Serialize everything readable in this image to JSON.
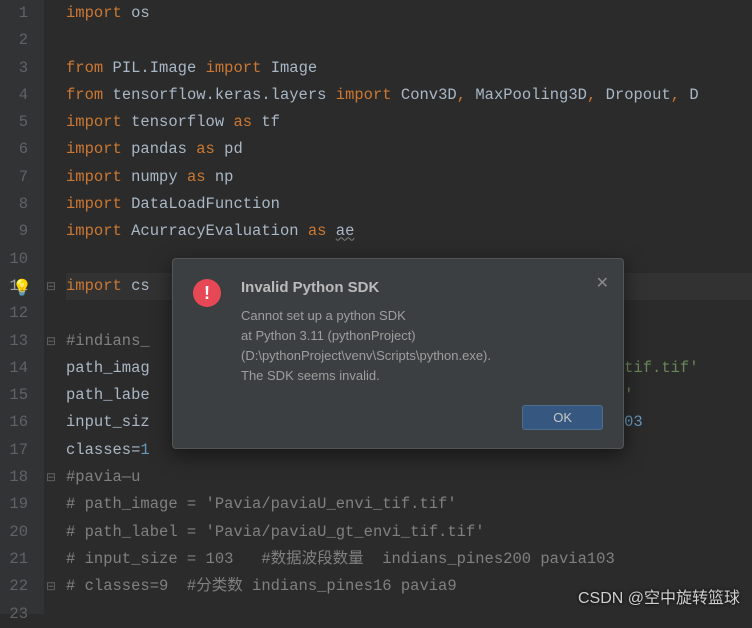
{
  "lines": [
    {
      "n": 1,
      "tokens": [
        [
          "kw",
          "import"
        ],
        [
          "sp",
          " "
        ],
        [
          "id",
          "os"
        ]
      ]
    },
    {
      "n": 2,
      "tokens": []
    },
    {
      "n": 3,
      "tokens": [
        [
          "kw",
          "from"
        ],
        [
          "sp",
          " "
        ],
        [
          "id",
          "PIL.Image"
        ],
        [
          "sp",
          " "
        ],
        [
          "kw",
          "import"
        ],
        [
          "sp",
          " "
        ],
        [
          "id",
          "Image"
        ]
      ]
    },
    {
      "n": 4,
      "tokens": [
        [
          "kw",
          "from"
        ],
        [
          "sp",
          " "
        ],
        [
          "id",
          "tensorflow.keras.layers"
        ],
        [
          "sp",
          " "
        ],
        [
          "kw",
          "import"
        ],
        [
          "sp",
          " "
        ],
        [
          "id",
          "Conv3D"
        ],
        [
          "kw",
          ","
        ],
        [
          "sp",
          " "
        ],
        [
          "id",
          "MaxPooling3D"
        ],
        [
          "kw",
          ","
        ],
        [
          "sp",
          " "
        ],
        [
          "id",
          "Dropout"
        ],
        [
          "kw",
          ","
        ],
        [
          "sp",
          " "
        ],
        [
          "id",
          "D"
        ]
      ]
    },
    {
      "n": 5,
      "tokens": [
        [
          "kw",
          "import"
        ],
        [
          "sp",
          " "
        ],
        [
          "id",
          "tensorflow"
        ],
        [
          "sp",
          " "
        ],
        [
          "kw",
          "as"
        ],
        [
          "sp",
          " "
        ],
        [
          "id",
          "tf"
        ]
      ]
    },
    {
      "n": 6,
      "tokens": [
        [
          "kw",
          "import"
        ],
        [
          "sp",
          " "
        ],
        [
          "id",
          "pandas"
        ],
        [
          "sp",
          " "
        ],
        [
          "kw",
          "as"
        ],
        [
          "sp",
          " "
        ],
        [
          "id",
          "pd"
        ]
      ]
    },
    {
      "n": 7,
      "tokens": [
        [
          "kw",
          "import"
        ],
        [
          "sp",
          " "
        ],
        [
          "id",
          "numpy"
        ],
        [
          "sp",
          " "
        ],
        [
          "kw",
          "as"
        ],
        [
          "sp",
          " "
        ],
        [
          "id",
          "np"
        ]
      ]
    },
    {
      "n": 8,
      "tokens": [
        [
          "kw",
          "import"
        ],
        [
          "sp",
          " "
        ],
        [
          "id",
          "DataLoadFunction"
        ]
      ]
    },
    {
      "n": 9,
      "tokens": [
        [
          "kw",
          "import"
        ],
        [
          "sp",
          " "
        ],
        [
          "id",
          "AcurracyEvaluation"
        ],
        [
          "sp",
          " "
        ],
        [
          "kw",
          "as"
        ],
        [
          "sp",
          " "
        ],
        [
          "warn",
          "ae"
        ]
      ]
    },
    {
      "n": 10,
      "tokens": []
    },
    {
      "n": 11,
      "cur": true,
      "tokens": [
        [
          "kw",
          "import"
        ],
        [
          "sp",
          " "
        ],
        [
          "id",
          "cs"
        ]
      ]
    },
    {
      "n": 12,
      "tokens": []
    },
    {
      "n": 13,
      "tokens": [
        [
          "cmt",
          "#indians_"
        ]
      ]
    },
    {
      "n": 14,
      "tokens": [
        [
          "id",
          "path_imag"
        ],
        [
          "sp",
          "                                                   "
        ],
        [
          "str",
          "tif.tif'"
        ]
      ]
    },
    {
      "n": 15,
      "tokens": [
        [
          "id",
          "path_labe"
        ],
        [
          "sp",
          "                                                   "
        ],
        [
          "str",
          "'"
        ]
      ]
    },
    {
      "n": 16,
      "tokens": [
        [
          "id",
          "input_siz"
        ],
        [
          "sp",
          "                                                   "
        ],
        [
          "num",
          "03"
        ]
      ]
    },
    {
      "n": 17,
      "tokens": [
        [
          "id",
          "classes="
        ],
        [
          "num",
          "1"
        ]
      ]
    },
    {
      "n": 18,
      "tokens": [
        [
          "cmt",
          "#pavia—u"
        ]
      ]
    },
    {
      "n": 19,
      "tokens": [
        [
          "cmt",
          "# path_image = 'Pavia/paviaU_envi_tif.tif'"
        ]
      ]
    },
    {
      "n": 20,
      "tokens": [
        [
          "cmt",
          "# path_label = 'Pavia/paviaU_gt_envi_tif.tif'"
        ]
      ]
    },
    {
      "n": 21,
      "tokens": [
        [
          "cmt",
          "# input_size = 103   #数据波段数量  indians_pines200 pavia103"
        ]
      ]
    },
    {
      "n": 22,
      "tokens": [
        [
          "cmt",
          "# classes=9  #分类数 indians_pines16 pavia9"
        ]
      ]
    },
    {
      "n": 23,
      "tokens": []
    }
  ],
  "dialog": {
    "title": "Invalid Python SDK",
    "line1": "Cannot set up a python SDK",
    "line2": "at Python 3.11 (pythonProject)",
    "line3": "(D:\\pythonProject\\venv\\Scripts\\python.exe).",
    "line4": "The SDK seems invalid.",
    "ok": "OK",
    "close": "✕",
    "icon": "!"
  },
  "watermark": "CSDN @空中旋转篮球",
  "bulb": "💡"
}
